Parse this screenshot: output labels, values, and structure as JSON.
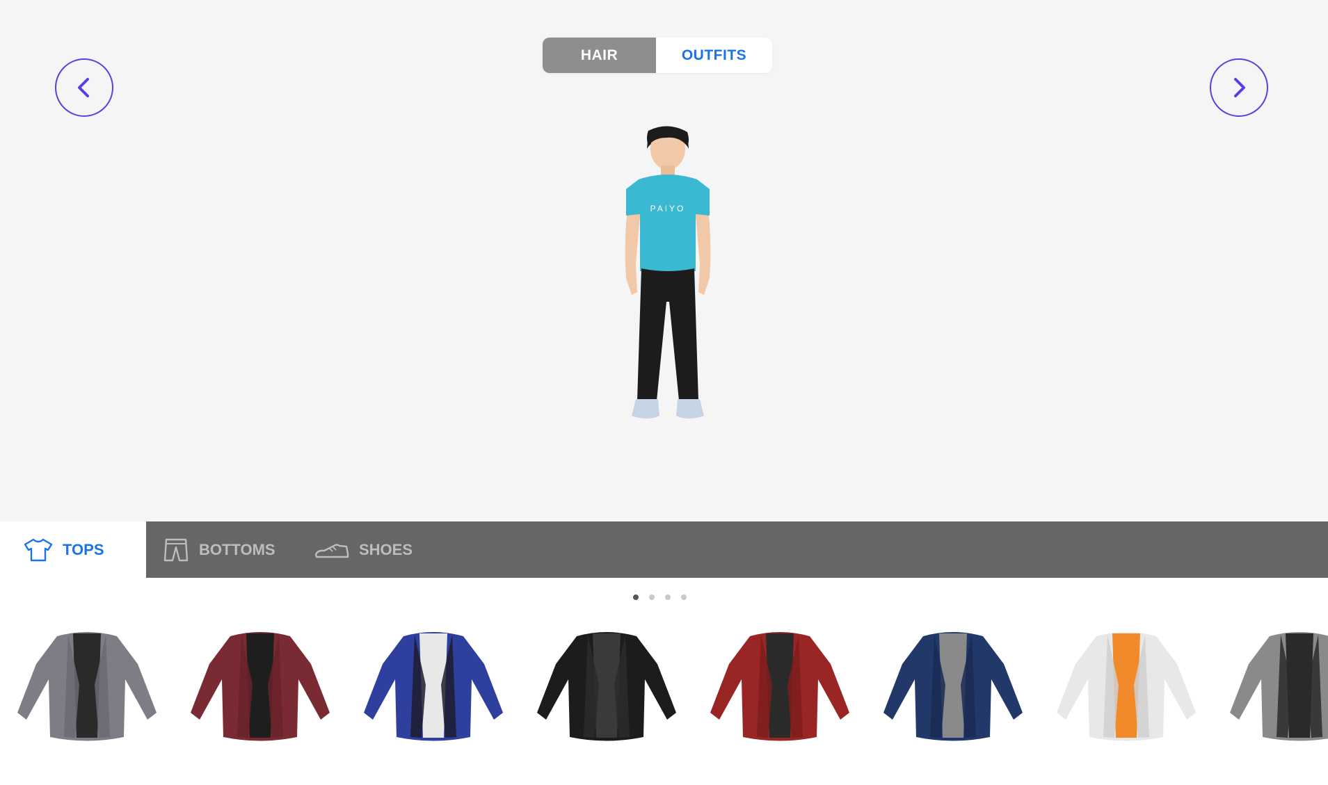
{
  "toggle": {
    "hair_label": "HAIR",
    "outfits_label": "OUTFITS",
    "active": "OUTFITS"
  },
  "avatar": {
    "shirt_text": "PAIYO",
    "shirt_color": "#3bb9d3"
  },
  "categories": [
    {
      "label": "TOPS",
      "icon": "tshirt-icon",
      "active": true
    },
    {
      "label": "BOTTOMS",
      "icon": "pants-icon",
      "active": false
    },
    {
      "label": "SHOES",
      "icon": "shoe-icon",
      "active": false
    }
  ],
  "pagination": {
    "pages": 4,
    "current": 1
  },
  "garments": [
    {
      "icon": "gray-blazer-icon",
      "body": "#7d7d85",
      "inner": "#2a2a2a",
      "lapel": "#6a6a72"
    },
    {
      "icon": "burgundy-blazer-icon",
      "body": "#7a2a33",
      "inner": "#1e1e1e",
      "lapel": "#6a222a"
    },
    {
      "icon": "blue-plaid-blazer-icon",
      "body": "#2e3f9e",
      "inner": "#e8e8e8",
      "lapel": "#1c1c2e"
    },
    {
      "icon": "black-leather-jacket-icon",
      "body": "#1c1c1c",
      "inner": "#3a3a3a",
      "lapel": "#2b2b2b"
    },
    {
      "icon": "red-leather-jacket-icon",
      "body": "#9a2525",
      "inner": "#2a2a2a",
      "lapel": "#7d1d1d"
    },
    {
      "icon": "navy-jacket-icon",
      "body": "#223868",
      "inner": "#8a8a8a",
      "lapel": "#1a2c54"
    },
    {
      "icon": "orange-white-jacket-icon",
      "body": "#e8e8e8",
      "inner": "#f08a2a",
      "lapel": "#d0d0d0"
    },
    {
      "icon": "gray-black-jacket-icon",
      "body": "#8a8a8a",
      "inner": "#2a2a2a",
      "lapel": "#2a2a2a"
    }
  ]
}
